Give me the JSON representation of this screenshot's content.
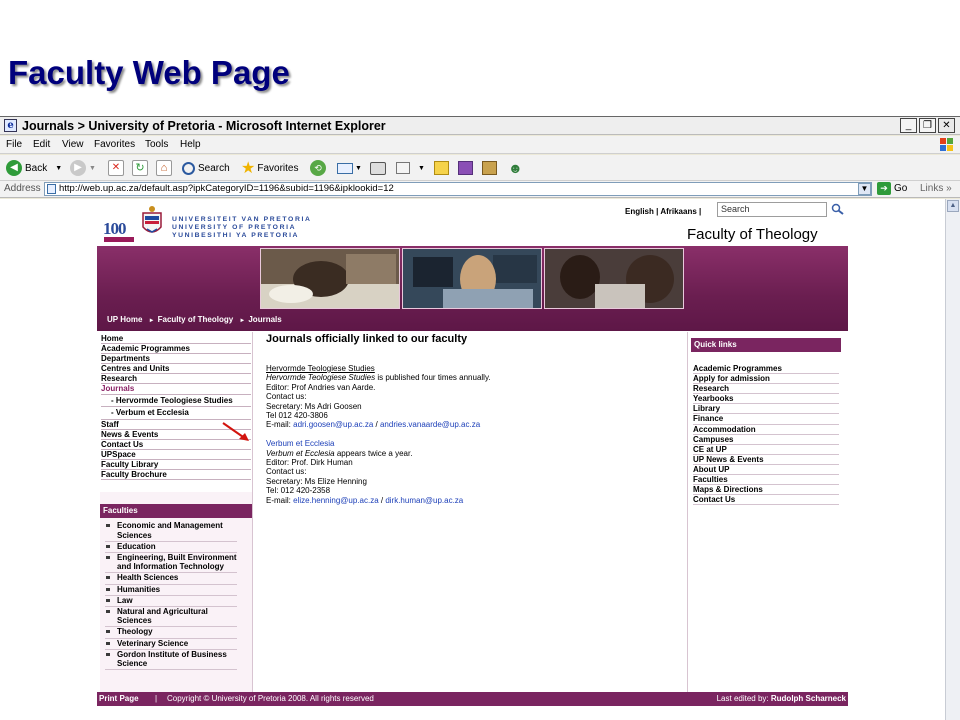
{
  "slide": {
    "title": "Faculty Web Page"
  },
  "window": {
    "title": "Journals > University of Pretoria - Microsoft Internet Explorer",
    "menu": [
      "File",
      "Edit",
      "View",
      "Favorites",
      "Tools",
      "Help"
    ],
    "toolbar": {
      "back": "Back",
      "search": "Search",
      "favorites": "Favorites"
    },
    "address": {
      "label": "Address",
      "url": "http://web.up.ac.za/default.asp?ipkCategoryID=1196&subid=1196&ipklookid=12",
      "go": "Go",
      "links": "Links"
    }
  },
  "site": {
    "logo_number": "100",
    "names": [
      "UNIVERSITEIT VAN PRETORIA",
      "UNIVERSITY OF PRETORIA",
      "YUNIBESITHI YA PRETORIA"
    ],
    "lang": {
      "english": "English",
      "sep1": "|",
      "afrikaans": "Afrikaans",
      "sep2": "|"
    },
    "search_placeholder": "Search",
    "faculty_name": "Faculty of Theology",
    "breadcrumb": [
      "UP Home",
      "Faculty of Theology",
      "Journals"
    ]
  },
  "left_nav": {
    "items": [
      "Home",
      "Academic Programmes",
      "Departments",
      "Centres and Units",
      "Research"
    ],
    "active": "Journals",
    "subitems": [
      "- Hervormde Teologiese Studies",
      "- Verbum et Ecclesia"
    ],
    "items2": [
      "Staff",
      "News & Events",
      "Contact Us",
      "UPSpace",
      "Faculty Library",
      "Faculty Brochure"
    ]
  },
  "faculties": {
    "header": "Faculties",
    "items": [
      "Economic and Management Sciences",
      "Education",
      "Engineering, Built Environment and Information Technology",
      "Health Sciences",
      "Humanities",
      "Law",
      "Natural and Agricultural Sciences",
      "Theology",
      "Veterinary Science",
      "Gordon Institute of Business Science"
    ]
  },
  "main": {
    "heading": "Journals officially linked to our faculty",
    "j1": {
      "title": "Hervormde Teologiese Studies",
      "desc_title": "Hervormde Teologiese Studies",
      "desc_rest": " is published four times annually.",
      "editor": "Editor: Prof Andries van Aarde.",
      "contact": "Contact us:",
      "secretary": "Secretary: Ms Adri Goosen",
      "tel": "Tel 012 420-3806",
      "email_label": "E-mail: ",
      "email1": "adri.goosen@up.ac.za",
      "email_sep": " / ",
      "email2": "andries.vanaarde@up.ac.za"
    },
    "j2": {
      "title": "Verbum et Ecclesia",
      "desc_title": "Verbum et Ecclesia",
      "desc_rest": " appears twice a year.",
      "editor": "Editor: Prof. Dirk Human",
      "contact": "Contact us:",
      "secretary": "Secretary: Ms Elize Henning",
      "tel": "Tel: 012 420-2358",
      "email_label": "E-mail: ",
      "email1": "elize.henning@up.ac.za",
      "email_sep": " / ",
      "email2": "dirk.human@up.ac.za"
    }
  },
  "quick_links": {
    "header": "Quick links",
    "items": [
      "Academic Programmes",
      "Apply for admission",
      "Research",
      "Yearbooks",
      "Library",
      "Finance",
      "Accommodation",
      "Campuses",
      "CE at UP",
      "UP News & Events",
      "About UP",
      "Faculties",
      "Maps & Directions",
      "Contact Us"
    ]
  },
  "footer": {
    "print": "Print Page",
    "sep": "|",
    "copyright": "Copyright © University of Pretoria 2008. All rights reserved",
    "edited_label": "Last edited by: ",
    "edited_by": "Rudolph Scharneck"
  },
  "colors": {
    "maroon": "#7a2560",
    "title_blue": "#00007c",
    "link_blue": "#1c3fb8"
  }
}
